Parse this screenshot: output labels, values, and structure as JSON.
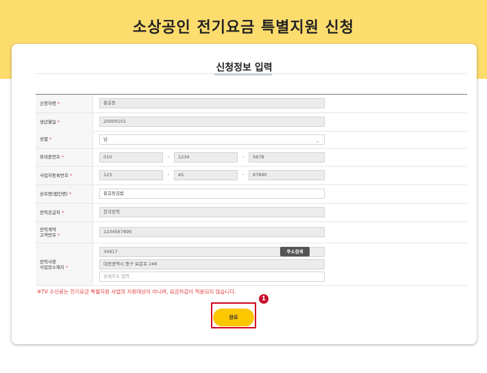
{
  "banner": {
    "title": "소상공인 전기요금 특별지원 신청"
  },
  "card": {
    "title": "신청정보 입력"
  },
  "required_mark": "*",
  "form": {
    "applicant_name": {
      "label": "신청자명",
      "value": "홍길동"
    },
    "birth_date": {
      "label": "생년월일",
      "value": "20000101"
    },
    "gender": {
      "label": "성별",
      "value": "남"
    },
    "phone": {
      "label": "휴대폰번호",
      "part1": "010",
      "part2": "1234",
      "part3": "5678",
      "separator": "-"
    },
    "business_number": {
      "label": "사업자등록번호",
      "part1": "123",
      "part2": "45",
      "part3": "67890",
      "separator": "-"
    },
    "company_name": {
      "label": "상호명(법인명)",
      "value": "홍길동김밥"
    },
    "power_supplier": {
      "label": "전력공급처",
      "value": "한국전력"
    },
    "customer_number": {
      "label_line1": "전력계약",
      "label_line2": "고객번호",
      "value": "1234567890"
    },
    "address": {
      "label_line1": "전력사용",
      "label_line2": "사업장소재지",
      "zipcode": "34917",
      "search_button": "주소검색",
      "address_line": "대전광역시 중구 보문로 246",
      "detail_placeholder": "상세주소 입력"
    }
  },
  "notice": "※TV 수신료는 전기요금 특별지원 사업의 지원대상이 아니며, 요금차감이 적용되지 않습니다.",
  "step_badge": "1",
  "submit_label": "완료",
  "colors": {
    "banner": "#fddc6e",
    "required": "#e23a3a",
    "button": "#fcc600",
    "highlight": "#d0021b"
  },
  "icons": {
    "gender_select": "chevron-down-icon"
  }
}
